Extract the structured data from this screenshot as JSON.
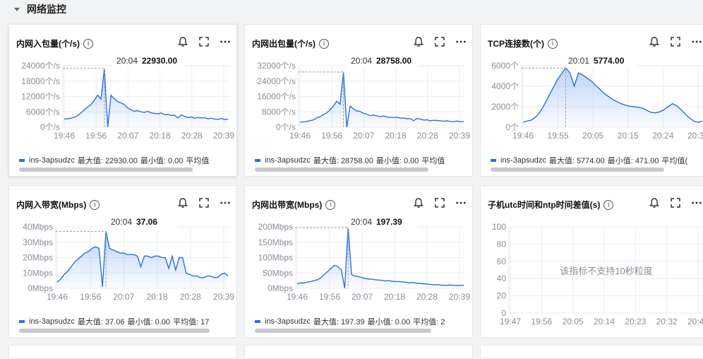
{
  "section": {
    "title": "网络监控"
  },
  "cards": [
    {
      "title": "内网入包量(个/s)",
      "tooltip": {
        "time": "20:04",
        "value": "22930.00"
      },
      "y_ticks": [
        "24000个/s",
        "18000个/s",
        "12000个/s",
        "6000个/s",
        "0个/s"
      ],
      "x_ticks": [
        "19:46",
        "19:56",
        "20:07",
        "20:18",
        "20:28",
        "20:39"
      ],
      "legend": {
        "name": "ins-3apsudzc",
        "max": "最大值: 22930.00",
        "min": "最小值: 0.00",
        "avg": "平均值"
      }
    },
    {
      "title": "内网出包量(个/s)",
      "tooltip": {
        "time": "20:04",
        "value": "28758.00"
      },
      "y_ticks": [
        "32000个/s",
        "24000个/s",
        "16000个/s",
        "8000个/s",
        "0个/s"
      ],
      "x_ticks": [
        "19:46",
        "19:56",
        "20:07",
        "20:18",
        "20:28",
        "20:39"
      ],
      "legend": {
        "name": "ins-3apsudzc",
        "max": "最大值: 28758.00",
        "min": "最小值: 0.00",
        "avg": "平均值"
      }
    },
    {
      "title": "TCP连接数(个)",
      "tooltip": {
        "time": "20:01",
        "value": "5774.00"
      },
      "y_ticks": [
        "6000个",
        "4000个",
        "2000个",
        "0个"
      ],
      "x_ticks": [
        "19:46",
        "19:55",
        "20:05",
        "20:15",
        "20:24",
        "20:34"
      ],
      "legend": {
        "name": "ins-3apsudzc",
        "max": "最大值: 5774.00",
        "min": "最小值: 471.00",
        "avg": "平均值("
      }
    },
    {
      "title": "内网入带宽(Mbps)",
      "tooltip": {
        "time": "20:04",
        "value": "37.06"
      },
      "y_ticks": [
        "40Mbps",
        "30Mbps",
        "20Mbps",
        "10Mbps",
        "0Mbps"
      ],
      "x_ticks": [
        "19:46",
        "19:56",
        "20:07",
        "20:18",
        "20:28",
        "20:39"
      ],
      "legend": {
        "name": "ins-3apsudzc",
        "max": "最大值: 37.06",
        "min": "最小值: 0.00",
        "avg": "平均值: 17"
      }
    },
    {
      "title": "内网出带宽(Mbps)",
      "tooltip": {
        "time": "20:04",
        "value": "197.39"
      },
      "y_ticks": [
        "200Mbps",
        "150Mbps",
        "100Mbps",
        "50Mbps",
        "0Mbps"
      ],
      "x_ticks": [
        "19:46",
        "19:56",
        "20:07",
        "20:18",
        "20:28",
        "20:39"
      ],
      "legend": {
        "name": "ins-3apsudzc",
        "max": "最大值: 197.39",
        "min": "最小值: 0.00",
        "avg": "平均值: 2"
      }
    },
    {
      "title": "子机utc时间和ntp时间差值(s)",
      "message": "该指标不支持10秒粒度",
      "y_ticks": [
        "100",
        "80",
        "60",
        "40",
        "20",
        "0"
      ],
      "x_ticks": [
        "19:47",
        "19:56",
        "20:05",
        "20:14",
        "20:23",
        "20:32",
        "20:41"
      ]
    }
  ],
  "chart_data": [
    {
      "type": "area",
      "title": "内网入包量(个/s)",
      "ylim": [
        0,
        24000
      ],
      "series": [
        {
          "name": "ins-3apsudzc",
          "values": [
            3200,
            3300,
            3500,
            3900,
            4500,
            5600,
            6800,
            7900,
            8800,
            10500,
            12500,
            11000,
            22930,
            0,
            12500,
            11000,
            10000,
            9500,
            8800,
            7500,
            6800,
            6200,
            6500,
            6000,
            5800,
            6200,
            5600,
            5400,
            5200,
            5600,
            4900,
            5000,
            4600,
            4700,
            3600,
            4800,
            4200,
            3800,
            4000,
            3500,
            3800,
            3600,
            3700,
            3300,
            3500,
            3200,
            3100,
            3400,
            3000,
            3200
          ]
        }
      ],
      "grid": true,
      "legend": "bottom-left"
    },
    {
      "type": "area",
      "title": "内网出包量(个/s)",
      "ylim": [
        0,
        32000
      ],
      "series": [
        {
          "name": "ins-3apsudzc",
          "values": [
            2600,
            2800,
            3000,
            3400,
            3800,
            4800,
            5500,
            6500,
            7500,
            9000,
            11000,
            13500,
            12000,
            28758,
            0,
            11000,
            9500,
            8500,
            8200,
            7200,
            6800,
            6000,
            6300,
            5900,
            5500,
            5800,
            5300,
            5100,
            5000,
            5200,
            4700,
            4800,
            4400,
            4500,
            3400,
            4600,
            4200,
            3700,
            3900,
            3300,
            3600,
            3500,
            3400,
            3100,
            3300,
            3000,
            2900,
            3200,
            2900,
            3000
          ]
        }
      ],
      "grid": true,
      "legend": "bottom-left"
    },
    {
      "type": "area",
      "title": "TCP连接数(个)",
      "ylim": [
        0,
        6000
      ],
      "series": [
        {
          "name": "ins-3apsudzc",
          "values": [
            500,
            600,
            700,
            1000,
            1500,
            2200,
            3000,
            3800,
            4600,
            5200,
            5774,
            5300,
            4000,
            5300,
            5100,
            4800,
            4500,
            4100,
            3700,
            3300,
            3000,
            2700,
            2500,
            2300,
            2150,
            2050,
            2000,
            1950,
            1850,
            1650,
            1450,
            1400,
            1500,
            1700,
            2000,
            2300,
            2100,
            1700,
            1300,
            900,
            600,
            471,
            600
          ]
        }
      ],
      "grid": true,
      "legend": "bottom-left"
    },
    {
      "type": "area",
      "title": "内网入带宽(Mbps)",
      "ylim": [
        0,
        40
      ],
      "series": [
        {
          "name": "ins-3apsudzc",
          "values": [
            4,
            6,
            9,
            11,
            14,
            17,
            19,
            21,
            23,
            24,
            26,
            27,
            26,
            1,
            37.06,
            26,
            25,
            24,
            23,
            23,
            22,
            22,
            22,
            21,
            14,
            21,
            21,
            20,
            21,
            21,
            20,
            20,
            13,
            21,
            12,
            20,
            20,
            10,
            9,
            8,
            8,
            7,
            7,
            8,
            8,
            7,
            7,
            9,
            10,
            8
          ]
        }
      ],
      "grid": true,
      "legend": "bottom-left"
    },
    {
      "type": "area",
      "title": "内网出带宽(Mbps)",
      "ylim": [
        0,
        200
      ],
      "series": [
        {
          "name": "ins-3apsudzc",
          "values": [
            15,
            18,
            17,
            20,
            22,
            25,
            28,
            35,
            45,
            55,
            65,
            75,
            70,
            60,
            0,
            197.39,
            45,
            40,
            38,
            35,
            32,
            30,
            30,
            28,
            27,
            26,
            24,
            25,
            23,
            22,
            22,
            21,
            20,
            18,
            19,
            17,
            16,
            15,
            14,
            13,
            12,
            12,
            11,
            10,
            10,
            11,
            10,
            9,
            10,
            10
          ]
        }
      ],
      "grid": true,
      "legend": "bottom-left"
    },
    {
      "type": "line",
      "title": "子机utc时间和ntp时间差值(s)",
      "ylim": [
        0,
        100
      ],
      "series": [],
      "grid": true
    }
  ]
}
